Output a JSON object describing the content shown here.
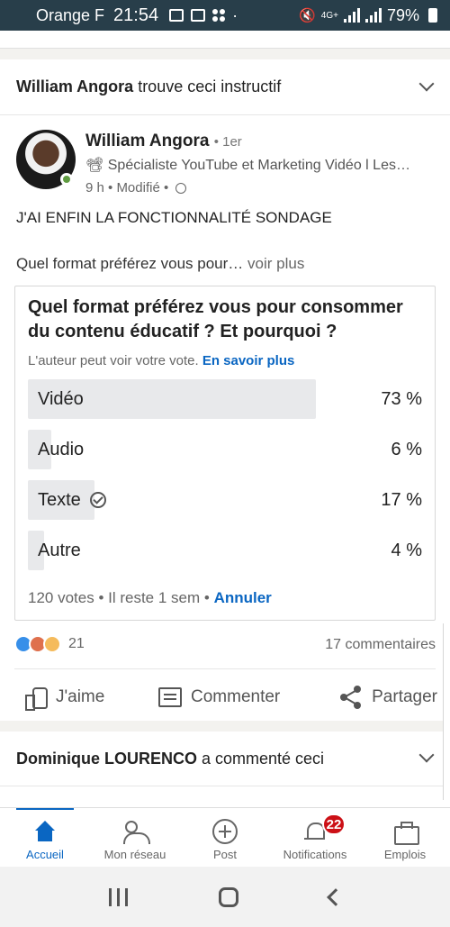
{
  "status_bar": {
    "carrier": "Orange F",
    "time": "21:54",
    "network": "4G+",
    "battery": "79%"
  },
  "feed": {
    "post": {
      "context_name": "William Angora",
      "context_action": "trouve ceci instructif",
      "author_name": "William Angora",
      "author_degree": "• 1er",
      "author_headline": "📽 Spécialiste YouTube et Marketing Vidéo l Les…",
      "meta": "9 h • Modifié •",
      "text": "J'AI ENFIN LA FONCTIONNALITÉ SONDAGE",
      "preview": "Quel format préférez vous pour…",
      "see_more": "voir plus",
      "poll": {
        "question": "Quel format préférez vous pour consommer du contenu éducatif ? Et pourquoi ?",
        "note": "L'auteur peut voir votre vote.",
        "learn_more": "En savoir plus",
        "options": [
          {
            "label": "Vidéo",
            "percent_label": "73 %",
            "percent": 73
          },
          {
            "label": "Audio",
            "percent_label": "6 %",
            "percent": 6
          },
          {
            "label": "Texte",
            "percent_label": "17 %",
            "percent": 17,
            "selected": true
          },
          {
            "label": "Autre",
            "percent_label": "4 %",
            "percent": 4
          }
        ],
        "footer": "120 votes • Il reste 1 sem •",
        "undo": "Annuler"
      },
      "reactions_count": "21",
      "comments_count": "17 commentaires",
      "actions": {
        "like": "J'aime",
        "comment": "Commenter",
        "share": "Partager"
      }
    },
    "next_post": {
      "context_name": "Dominique LOURENCO",
      "context_action": "a commenté ceci"
    }
  },
  "bottom_nav": {
    "home": "Accueil",
    "network": "Mon réseau",
    "post": "Post",
    "notifications": "Notifications",
    "notifications_badge": "22",
    "jobs": "Emplois"
  },
  "colors": {
    "accent": "#0a66c2",
    "status_bar": "#283e4a",
    "badge": "#cc1016"
  }
}
